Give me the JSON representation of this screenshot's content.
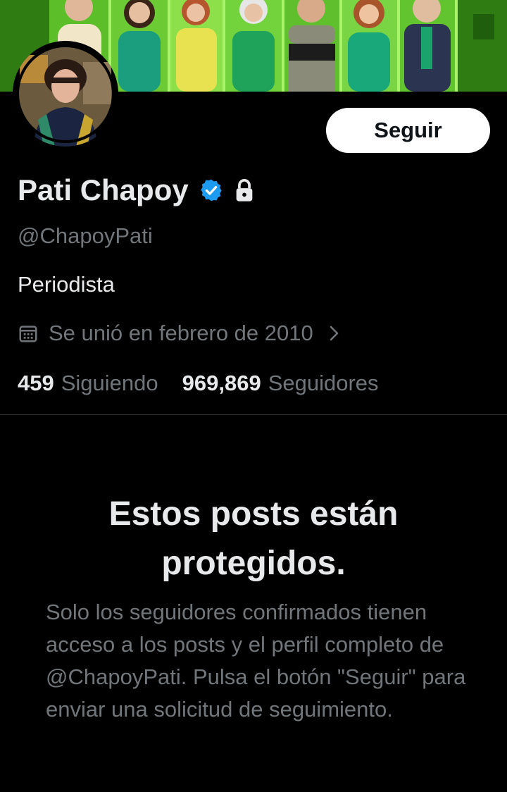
{
  "profile": {
    "follow_label": "Seguir",
    "name": "Pati Chapoy",
    "handle": "@ChapoyPati",
    "bio": "Periodista",
    "joined": "Se unió en febrero de 2010",
    "stats": {
      "following_count": "459",
      "following_label": "Siguiendo",
      "followers_count": "969,869",
      "followers_label": "Seguidores"
    }
  },
  "protected": {
    "title": "Estos posts están protegidos.",
    "body": "Solo los seguidores confirmados tienen acceso a los posts y el perfil completo de @ChapoyPati. Pulsa el botón \"Seguir\" para enviar una solicitud de seguimiento."
  },
  "icons": {
    "verified": "verified-badge-icon",
    "lock": "lock-icon",
    "calendar": "calendar-icon",
    "chevron": "chevron-right-icon"
  },
  "colors": {
    "background": "#000000",
    "text_primary": "#e7e9ea",
    "text_secondary": "#71767b",
    "verified_blue": "#1d9bf0",
    "banner_green": "#3f9a1c",
    "divider": "#2f3336"
  }
}
